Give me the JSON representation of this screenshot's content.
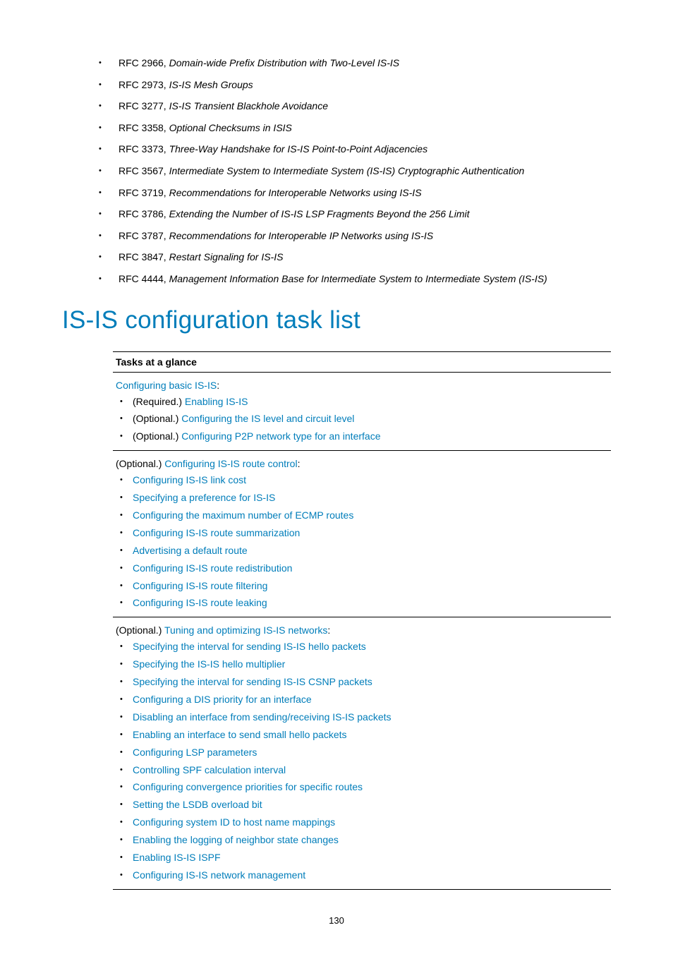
{
  "rfcs": [
    {
      "code": "RFC 2966, ",
      "title": "Domain-wide Prefix Distribution with Two-Level IS-IS"
    },
    {
      "code": "RFC 2973, ",
      "title": "IS-IS Mesh Groups"
    },
    {
      "code": "RFC 3277, ",
      "title": "IS-IS Transient Blackhole Avoidance"
    },
    {
      "code": "RFC 3358, ",
      "title": "Optional Checksums in ISIS"
    },
    {
      "code": "RFC 3373, ",
      "title": "Three-Way Handshake for IS-IS Point-to-Point Adjacencies"
    },
    {
      "code": "RFC 3567, ",
      "title": "Intermediate System to Intermediate System (IS-IS) Cryptographic Authentication"
    },
    {
      "code": "RFC 3719, ",
      "title": "Recommendations for Interoperable Networks using IS-IS"
    },
    {
      "code": "RFC 3786, ",
      "title": "Extending the Number of IS-IS LSP Fragments Beyond the 256 Limit"
    },
    {
      "code": "RFC 3787, ",
      "title": "Recommendations for Interoperable IP Networks using IS-IS"
    },
    {
      "code": "RFC 3847, ",
      "title": "Restart Signaling for IS-IS"
    },
    {
      "code": "RFC 4444, ",
      "title": "Management Information Base for Intermediate System to Intermediate System (IS-IS)"
    }
  ],
  "heading": "IS-IS configuration task list",
  "table": {
    "header": "Tasks at a glance",
    "rows": [
      {
        "intro_prefix": "",
        "intro_link": "Configuring basic IS-IS",
        "intro_suffix": ":",
        "items": [
          {
            "prefix": "(Required.) ",
            "link": "Enabling IS-IS"
          },
          {
            "prefix": "(Optional.) ",
            "link": "Configuring the IS level and circuit level"
          },
          {
            "prefix": "(Optional.) ",
            "link": "Configuring P2P network type for an interface"
          }
        ]
      },
      {
        "intro_prefix": "(Optional.) ",
        "intro_link": "Configuring IS-IS route control",
        "intro_suffix": ":",
        "items": [
          {
            "prefix": "",
            "link": "Configuring IS-IS link cost"
          },
          {
            "prefix": "",
            "link": "Specifying a preference for IS-IS"
          },
          {
            "prefix": "",
            "link": "Configuring the maximum number of ECMP routes"
          },
          {
            "prefix": "",
            "link": "Configuring IS-IS route summarization"
          },
          {
            "prefix": "",
            "link": "Advertising a default route"
          },
          {
            "prefix": "",
            "link": "Configuring IS-IS route redistribution"
          },
          {
            "prefix": "",
            "link": "Configuring IS-IS route filtering"
          },
          {
            "prefix": "",
            "link": "Configuring IS-IS route leaking"
          }
        ]
      },
      {
        "intro_prefix": "(Optional.) ",
        "intro_link": "Tuning and optimizing IS-IS networks",
        "intro_suffix": ":",
        "items": [
          {
            "prefix": "",
            "link": "Specifying the interval for sending IS-IS hello packets"
          },
          {
            "prefix": "",
            "link": "Specifying the IS-IS hello multiplier"
          },
          {
            "prefix": "",
            "link": "Specifying the interval for sending IS-IS CSNP packets"
          },
          {
            "prefix": "",
            "link": "Configuring a DIS priority for an interface"
          },
          {
            "prefix": "",
            "link": "Disabling an interface from sending/receiving IS-IS packets"
          },
          {
            "prefix": "",
            "link": "Enabling an interface to send small hello packets"
          },
          {
            "prefix": "",
            "link": "Configuring LSP parameters"
          },
          {
            "prefix": "",
            "link": "Controlling SPF calculation interval"
          },
          {
            "prefix": "",
            "link": "Configuring convergence priorities for specific routes"
          },
          {
            "prefix": "",
            "link": "Setting the LSDB overload bit"
          },
          {
            "prefix": "",
            "link": "Configuring system ID to host name mappings"
          },
          {
            "prefix": "",
            "link": "Enabling the logging of neighbor state changes"
          },
          {
            "prefix": "",
            "link": "Enabling IS-IS ISPF"
          },
          {
            "prefix": "",
            "link": "Configuring IS-IS network management"
          }
        ]
      }
    ]
  },
  "page_number": "130"
}
